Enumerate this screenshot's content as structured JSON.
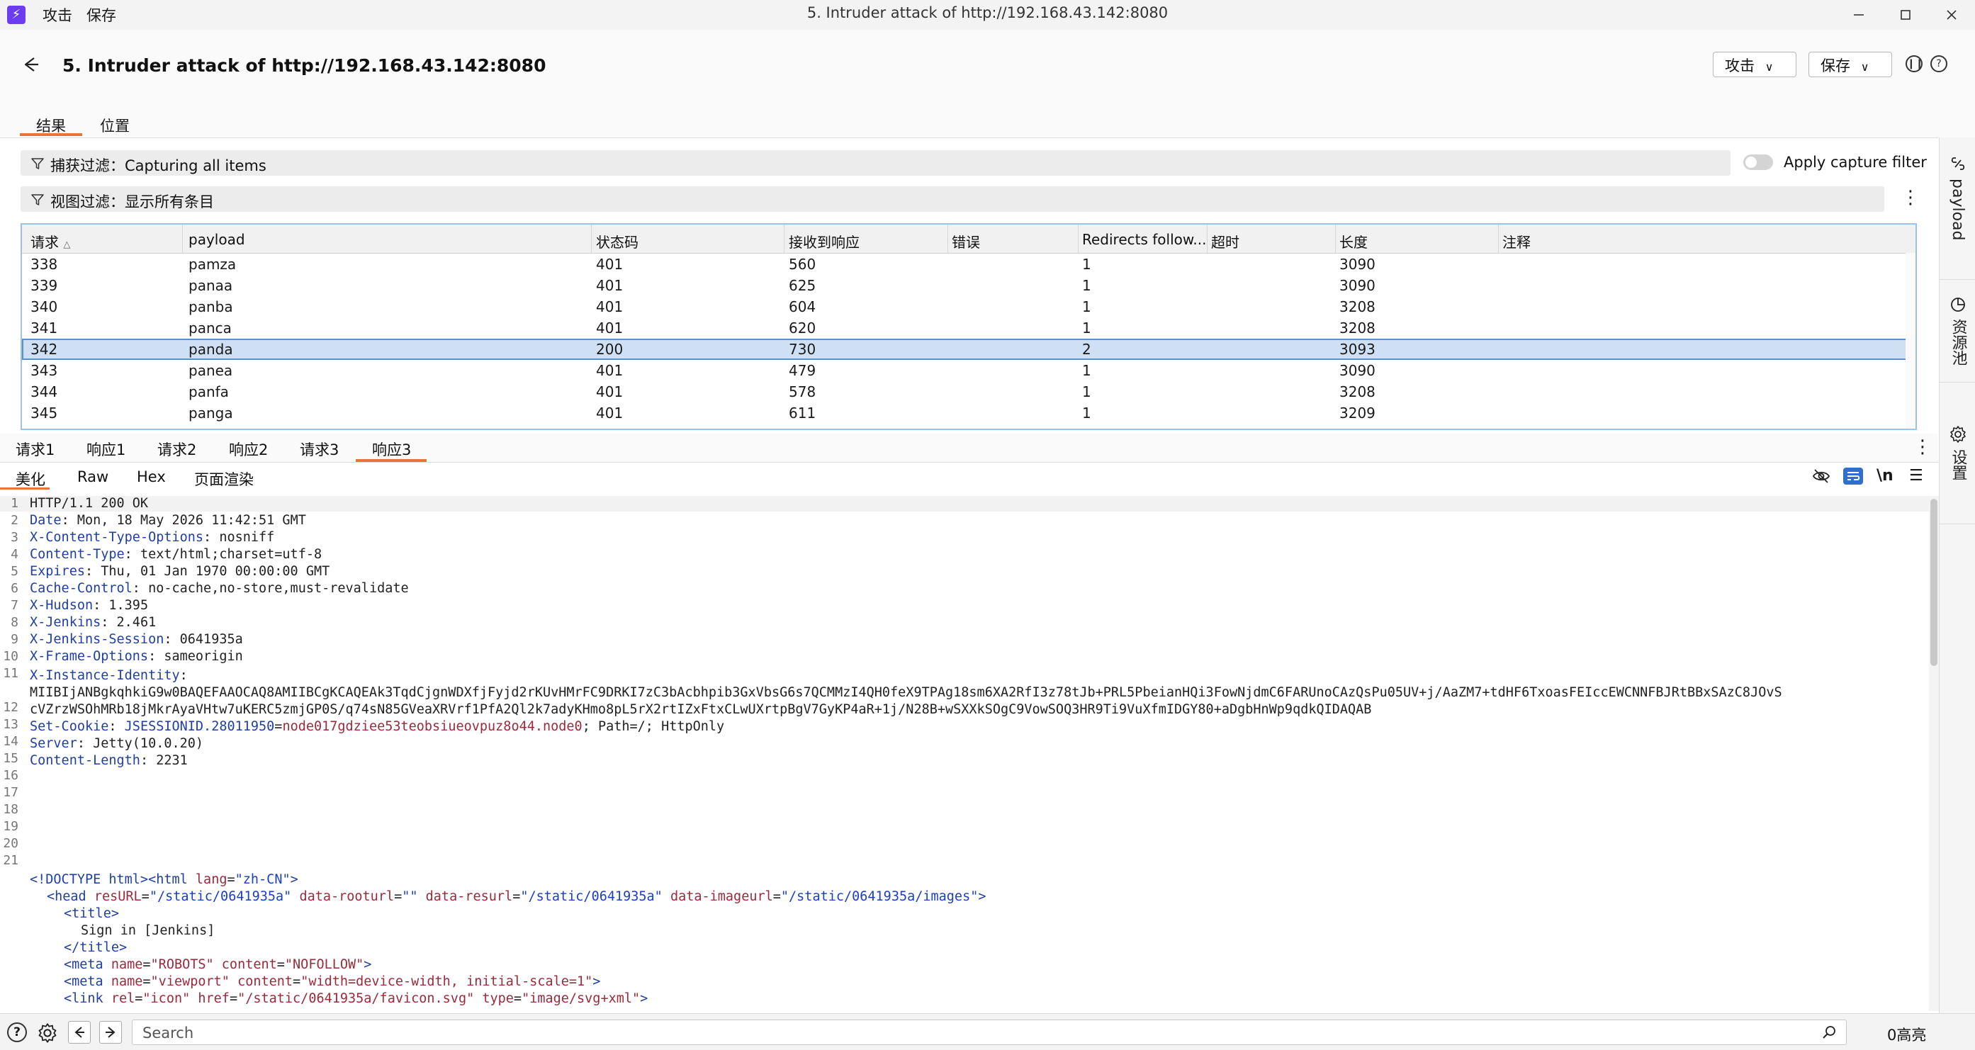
{
  "titlebar": {
    "menu": [
      "攻击",
      "保存"
    ],
    "window_title": "5. Intruder attack of http://192.168.43.142:8080"
  },
  "header": {
    "title": "5. Intruder attack of http://192.168.43.142:8080",
    "attack_dropdown": "攻击",
    "save_dropdown": "保存"
  },
  "main_tabs": [
    "结果",
    "位置"
  ],
  "filters": {
    "capture_label": "捕获过滤：Capturing all items",
    "view_label": "视图过滤：显示所有条目",
    "apply_capture_filter": "Apply capture filter"
  },
  "table": {
    "columns": [
      "请求",
      "payload",
      "状态码",
      "接收到响应",
      "错误",
      "Redirects follow...",
      "超时",
      "长度",
      "注释"
    ],
    "rows": [
      [
        "338",
        "pamza",
        "401",
        "560",
        "",
        "1",
        "",
        "3090",
        ""
      ],
      [
        "339",
        "panaa",
        "401",
        "625",
        "",
        "1",
        "",
        "3090",
        ""
      ],
      [
        "340",
        "panba",
        "401",
        "604",
        "",
        "1",
        "",
        "3208",
        ""
      ],
      [
        "341",
        "panca",
        "401",
        "620",
        "",
        "1",
        "",
        "3208",
        ""
      ],
      [
        "342",
        "panda",
        "200",
        "730",
        "",
        "2",
        "",
        "3093",
        ""
      ],
      [
        "343",
        "panea",
        "401",
        "479",
        "",
        "1",
        "",
        "3090",
        ""
      ],
      [
        "344",
        "panfa",
        "401",
        "578",
        "",
        "1",
        "",
        "3208",
        ""
      ],
      [
        "345",
        "panga",
        "401",
        "611",
        "",
        "1",
        "",
        "3209",
        ""
      ]
    ],
    "selected_request": "342"
  },
  "sub_tabs": [
    "请求1",
    "响应1",
    "请求2",
    "响应2",
    "请求3",
    "响应3"
  ],
  "active_sub_tab": "响应3",
  "view_tabs": [
    "美化",
    "Raw",
    "Hex",
    "页面渲染"
  ],
  "active_view_tab": "美化",
  "response": {
    "status_line": "HTTP/1.1 200 OK",
    "headers": [
      {
        "name": "Date",
        "value": "Mon, 18 May 2026 11:42:51 GMT"
      },
      {
        "name": "X-Content-Type-Options",
        "value": "nosniff"
      },
      {
        "name": "Content-Type",
        "value": "text/html;charset=utf-8"
      },
      {
        "name": "Expires",
        "value": "Thu, 01 Jan 1970 00:00:00 GMT"
      },
      {
        "name": "Cache-Control",
        "value": "no-cache,no-store,must-revalidate"
      },
      {
        "name": "X-Hudson",
        "value": "1.395"
      },
      {
        "name": "X-Jenkins",
        "value": "2.461"
      },
      {
        "name": "X-Jenkins-Session",
        "value": "0641935a"
      },
      {
        "name": "X-Frame-Options",
        "value": "sameorigin"
      }
    ],
    "instance_identity_name": "X-Instance-Identity",
    "instance_identity_value_1": "MIIBIjANBgkqhkiG9w0BAQEFAAOCAQ8AMIIBCgKCAQEAk3TqdCjgnWDXfjFyjd2rKUvHMrFC9DRKI7zC3bAcbhpib3GxVbsG6s7QCMMzI4QH0feX9TPAg18sm6XA2RfI3z78tJb+PRL5PbeianHQi3FowNjdmC6FARUnoCAzQsPu05UV+j/AaZM7+tdHF6TxoasFEIccEWCNNFBJRtBBxSAzC8JOvS",
    "instance_identity_value_2": "cVZrzWSOhMRb18jMkrAyaVHtw7uKERC5zmjGP0S/q74sN85GVeaXRVrf1PfA2Ql2k7adyKHmo8pL5rX2rtIZxFtxCLwUXrtpBgV7GyKP4aR+1j/N28B+wSXXkSOgC9VowSOQ3HR9Ti9VuXfmIDGY80+aDgbHnWp9qdkQIDAQAB",
    "cookie_name": "Set-Cookie",
    "cookie_key": "JSESSIONID.28011950",
    "cookie_value": "node017gdziee53teobsiueovpuz8o44.node0",
    "cookie_rest": "; Path=/; HttpOnly",
    "server": {
      "name": "Server",
      "value": "Jetty(10.0.20)"
    },
    "content_length": {
      "name": "Content-Length",
      "value": "2231"
    },
    "html": {
      "doctype": "<!DOCTYPE html>",
      "html_open": "<html",
      "html_lang_attr": "lang",
      "html_lang_val": "\"zh-CN\"",
      "head_open": "<head",
      "head_attrs": [
        {
          "name": "resURL",
          "value": "\"/static/0641935a\""
        },
        {
          "name": "data-rooturl",
          "value": "\"\""
        },
        {
          "name": "data-resurl",
          "value": "\"/static/0641935a\""
        },
        {
          "name": "data-imageurl",
          "value": "\"/static/0641935a/images\""
        }
      ],
      "title_open": "<title>",
      "title_text": "Sign in [Jenkins]",
      "title_close": "</title>",
      "meta1": {
        "name": "\"ROBOTS\"",
        "content": "\"NOFOLLOW\""
      },
      "meta2": {
        "name": "\"viewport\"",
        "content": "\"width=device-width, initial-scale=1\""
      },
      "link": {
        "rel": "\"icon\"",
        "href": "\"/static/0641935a/favicon.svg\"",
        "type": "\"image/svg+xml\""
      }
    }
  },
  "line_numbers": [
    "1",
    "2",
    "3",
    "4",
    "5",
    "6",
    "7",
    "8",
    "9",
    "10",
    "11",
    "",
    "12",
    "13",
    "14",
    "15",
    "16",
    "17",
    "18",
    "19",
    "20",
    "21",
    "",
    "",
    "",
    "",
    "",
    "",
    ""
  ],
  "sidebar": {
    "payload": "payload",
    "resource_pool": "资源池",
    "settings": "设置"
  },
  "bottom": {
    "search_placeholder": "Search",
    "highlight_count": "0高亮"
  }
}
